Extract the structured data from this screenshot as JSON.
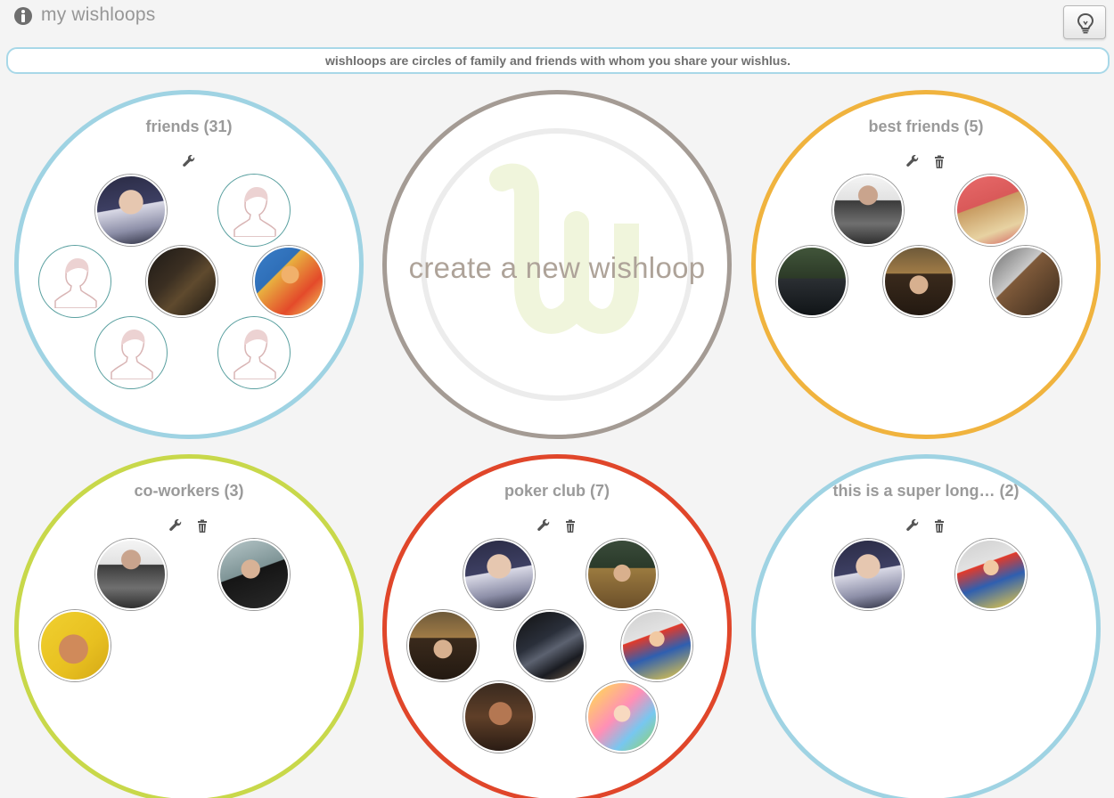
{
  "header": {
    "title": "my wishloops",
    "info_icon": "info-icon",
    "tips_icon": "lightbulb-icon"
  },
  "banner": {
    "text": "wishloops are circles of family and friends with whom you share your wishlus."
  },
  "colors": {
    "friends": "#9fd3e3",
    "create": "#a49b94",
    "best_friends": "#f0b33e",
    "co_workers": "#c8d84a",
    "poker_club": "#e0462a",
    "super_long": "#9fd3e3"
  },
  "loops": {
    "friends": {
      "title": "friends (31)",
      "tools": [
        "wrench-icon"
      ]
    },
    "create": {
      "label": "create a new wishloop"
    },
    "best_friends": {
      "title": "best friends (5)",
      "tools": [
        "wrench-icon",
        "trash-icon"
      ]
    },
    "co_workers": {
      "title": "co-workers (3)",
      "tools": [
        "wrench-icon",
        "trash-icon"
      ]
    },
    "poker_club": {
      "title": "poker club (7)",
      "tools": [
        "wrench-icon",
        "trash-icon"
      ]
    },
    "super_long": {
      "title": "this is a super long… (2)",
      "tools": [
        "wrench-icon",
        "trash-icon"
      ]
    }
  }
}
